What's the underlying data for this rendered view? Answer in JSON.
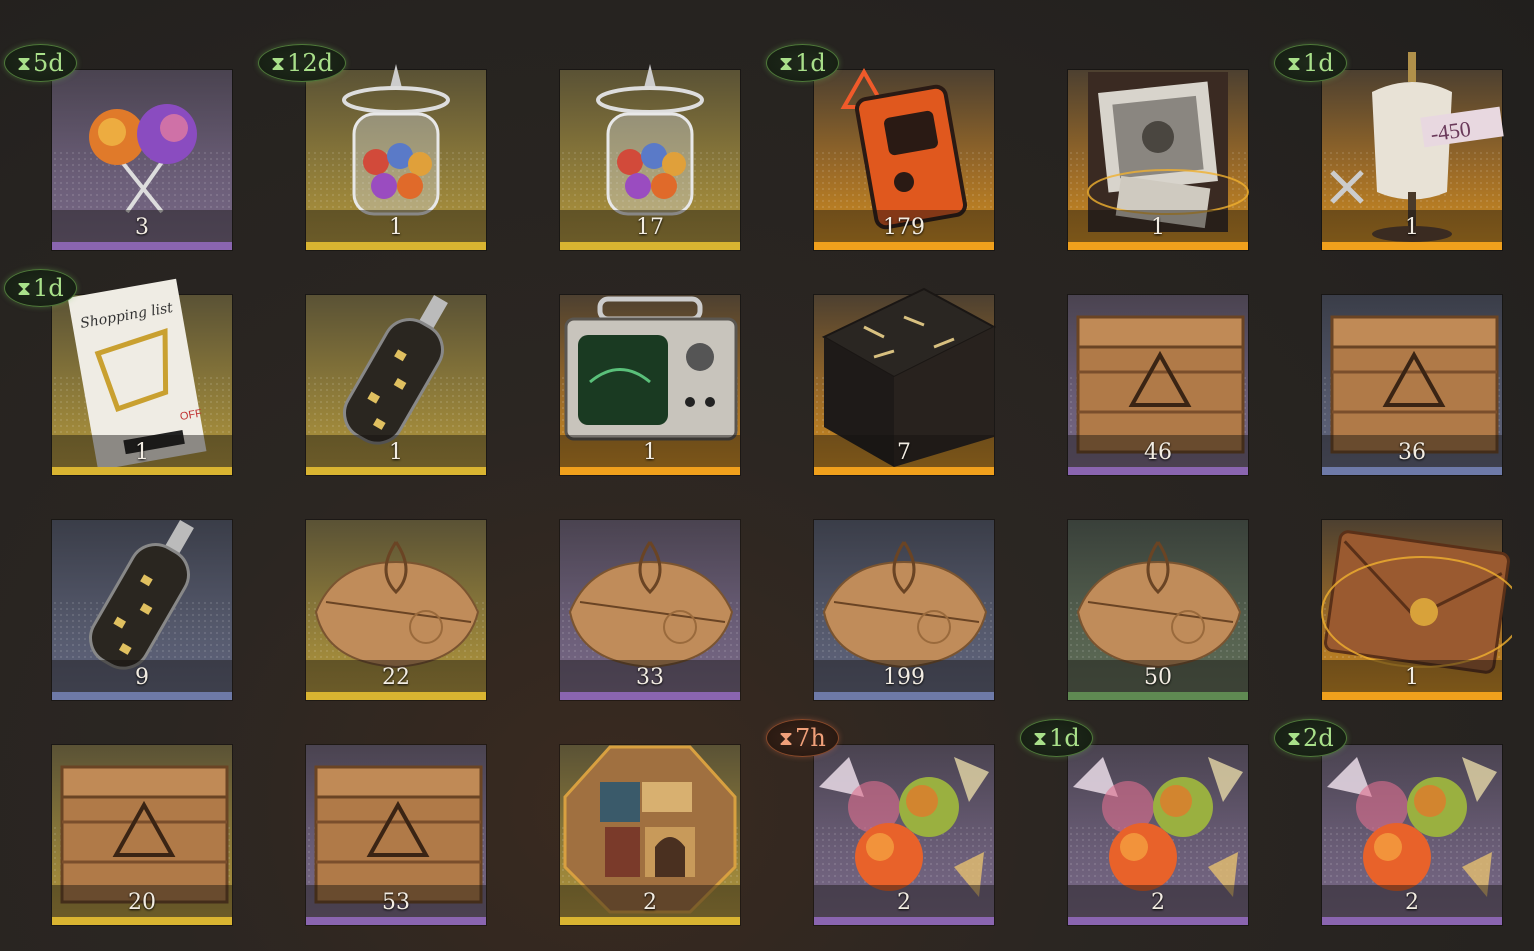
{
  "colors": {
    "rarity_purple": "#8a65b0",
    "rarity_gold": "#d9b431",
    "rarity_orange": "#f0a01c",
    "rarity_blue": "#6e7aa8",
    "rarity_green": "#5f8a52",
    "timer_green": "#a9e08a",
    "timer_red": "#f0a07a"
  },
  "hourglass_icon": "⧗",
  "items": [
    {
      "name": "lollipops",
      "icon": "lollipop-icon",
      "count": "3",
      "rarity": "purple",
      "timer": "5d"
    },
    {
      "name": "candy-jar",
      "icon": "candy-jar-icon",
      "count": "1",
      "rarity": "gold",
      "timer": "12d"
    },
    {
      "name": "candy-jar",
      "icon": "candy-jar-icon",
      "count": "17",
      "rarity": "gold",
      "timer": ""
    },
    {
      "name": "orange-device",
      "icon": "orange-device-icon",
      "count": "179",
      "rarity": "orange",
      "timer": "1d"
    },
    {
      "name": "photo-box",
      "icon": "photo-box-icon",
      "count": "1",
      "rarity": "orange",
      "timer": ""
    },
    {
      "name": "mannequin-coupon",
      "icon": "mannequin-icon",
      "count": "1",
      "rarity": "orange",
      "timer": "1d",
      "tag": "-450"
    },
    {
      "name": "shopping-list",
      "icon": "shopping-list-icon",
      "count": "1",
      "rarity": "gold",
      "timer": "1d",
      "title": "Shopping list",
      "off": "OFF"
    },
    {
      "name": "bottle",
      "icon": "bottle-icon",
      "count": "1",
      "rarity": "gold",
      "timer": ""
    },
    {
      "name": "radio-monitor",
      "icon": "radio-monitor-icon",
      "count": "1",
      "rarity": "orange",
      "timer": ""
    },
    {
      "name": "rune-table",
      "icon": "rune-table-icon",
      "count": "7",
      "rarity": "orange",
      "timer": ""
    },
    {
      "name": "wooden-crate",
      "icon": "crate-icon",
      "count": "46",
      "rarity": "purple",
      "timer": ""
    },
    {
      "name": "wooden-crate",
      "icon": "crate-icon",
      "count": "36",
      "rarity": "blue",
      "timer": ""
    },
    {
      "name": "bottle",
      "icon": "bottle-icon",
      "count": "9",
      "rarity": "blue",
      "timer": ""
    },
    {
      "name": "parcel",
      "icon": "parcel-icon",
      "count": "22",
      "rarity": "gold",
      "timer": ""
    },
    {
      "name": "parcel",
      "icon": "parcel-icon",
      "count": "33",
      "rarity": "purple",
      "timer": ""
    },
    {
      "name": "parcel",
      "icon": "parcel-icon",
      "count": "199",
      "rarity": "blue",
      "timer": ""
    },
    {
      "name": "parcel",
      "icon": "parcel-icon",
      "count": "50",
      "rarity": "green",
      "timer": ""
    },
    {
      "name": "envelope",
      "icon": "envelope-icon",
      "count": "1",
      "rarity": "orange",
      "timer": ""
    },
    {
      "name": "wooden-crate",
      "icon": "crate-icon",
      "count": "20",
      "rarity": "gold",
      "timer": ""
    },
    {
      "name": "wooden-crate",
      "icon": "crate-icon",
      "count": "53",
      "rarity": "purple",
      "timer": ""
    },
    {
      "name": "puzzle-box",
      "icon": "puzzle-box-icon",
      "count": "2",
      "rarity": "gold",
      "timer": ""
    },
    {
      "name": "candies",
      "icon": "candy-icon",
      "count": "2",
      "rarity": "purple",
      "timer": "7h",
      "timer_style": "red"
    },
    {
      "name": "candies",
      "icon": "candy-icon",
      "count": "2",
      "rarity": "purple",
      "timer": "1d"
    },
    {
      "name": "candies",
      "icon": "candy-icon",
      "count": "2",
      "rarity": "purple",
      "timer": "2d"
    }
  ]
}
